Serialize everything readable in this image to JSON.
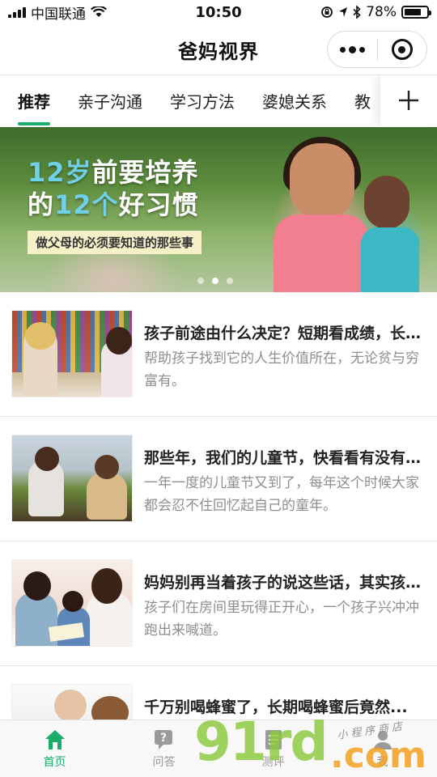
{
  "status_bar": {
    "carrier": "中国联通",
    "time": "10:50",
    "battery_percent": "78%",
    "battery_level": 0.78
  },
  "header": {
    "title": "爸妈视界",
    "capsule_icons": [
      "more-icon",
      "close-target-icon"
    ]
  },
  "tabs": {
    "items": [
      "推荐",
      "亲子沟通",
      "学习方法",
      "婆媳关系",
      "教"
    ],
    "active": "推荐",
    "add_icon": "plus-icon"
  },
  "banner": {
    "line1_hl": "12岁",
    "line1_rest": "前要培养",
    "line2_a": "的",
    "line2_hl": "12个",
    "line2_b": "好习惯",
    "subtitle": "做父母的必须要知道的那些事",
    "slide_count": 3,
    "active_slide": 1
  },
  "articles": [
    {
      "title": "孩子前途由什么决定？短期看成绩，长期看...",
      "desc": "帮助孩子找到它的人生价值所在，无论贫与穷富有。"
    },
    {
      "title": "那些年，我们的儿童节，快看看有没有你...",
      "desc": "一年一度的儿童节又到了，每年这个时候大家都会忍不住回忆起自己的童年。"
    },
    {
      "title": "妈妈别再当着孩子的说这些话，其实孩子...",
      "desc": "孩子们在房间里玩得正开心，一个孩子兴冲冲跑出来喊道。"
    },
    {
      "title": "千万别喝蜂蜜了，长期喝蜂蜜后竟然...",
      "desc": ""
    }
  ],
  "tabbar": {
    "items": [
      {
        "label": "首页",
        "icon": "home-icon",
        "active": true
      },
      {
        "label": "问答",
        "icon": "qa-bubble-icon",
        "active": false
      },
      {
        "label": "测评",
        "icon": "evaluation-icon",
        "active": false
      },
      {
        "label": "我",
        "icon": "user-icon",
        "active": false
      }
    ]
  },
  "watermark": {
    "brand": "91rd",
    "domain": ".com",
    "tagline": "小程序商店"
  },
  "colors": {
    "accent": "#1aad6a",
    "text_gray": "#8e8e8e",
    "banner_highlight": "#6fd0e6"
  }
}
